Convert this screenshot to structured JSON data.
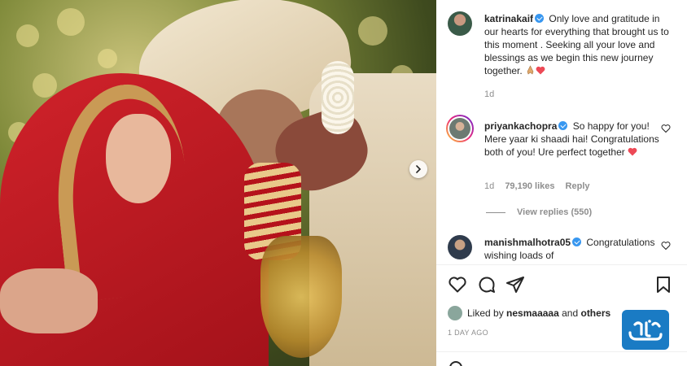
{
  "post": {
    "caption": {
      "username": "katrinakaif",
      "text": "Only love and gratitude in our hearts for everything that brought us to this moment . Seeking all your love and blessings as we begin this new journey together.",
      "time": "1d"
    },
    "comments": [
      {
        "username": "priyankachopra",
        "text": "So happy for you! Mere yaar ki shaadi hai! Congratulations both of you! Ure perfect together",
        "time": "1d",
        "likes": "79,190 likes",
        "reply_label": "Reply",
        "view_replies": "View replies (550)"
      },
      {
        "username": "manishmalhotra05",
        "text": "Congratulations wishing loads of"
      }
    ],
    "liked_by": {
      "prefix": "Liked by",
      "user": "nesmaaaaa",
      "connector": "and",
      "others": "others"
    },
    "timestamp": "1 DAY AGO"
  },
  "icons": {
    "like": "heart-icon",
    "comment": "comment-icon",
    "share": "paper-plane-icon",
    "save": "bookmark-icon",
    "next": "chevron-right-icon"
  },
  "colors": {
    "verified": "#3897f0",
    "heart_red": "#ed4956",
    "muted": "#8e8e8e",
    "watermark_bg": "#1a7bc4"
  }
}
